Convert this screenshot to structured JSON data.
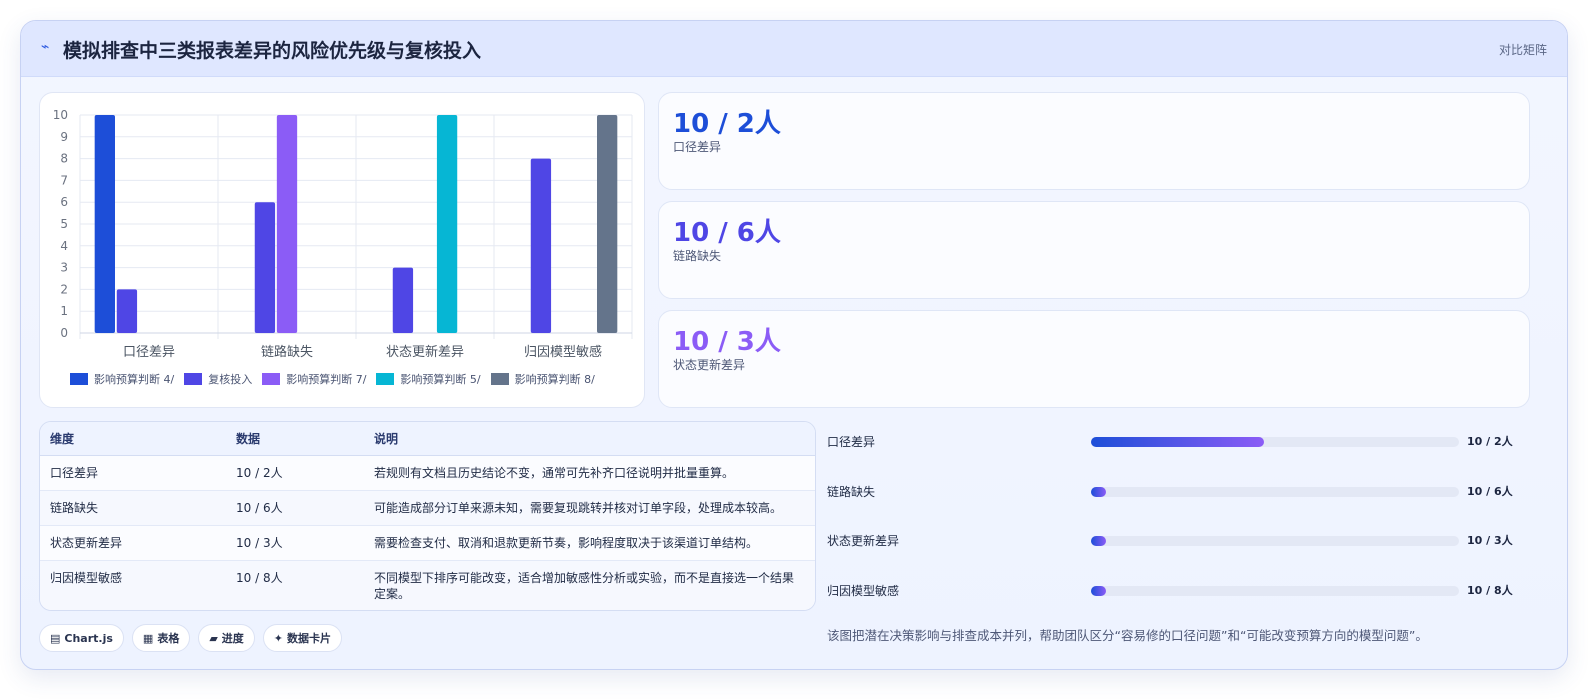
{
  "header": {
    "icon": "lightning-icon",
    "title": "模拟排查中三类报表差异的风险优先级与复核投入",
    "right_label": "对比矩阵"
  },
  "chart_data": {
    "type": "bar",
    "categories": [
      "口径差异",
      "链路缺失",
      "状态更新差异",
      "归因模型敏感"
    ],
    "ylim": [
      0,
      10
    ],
    "yticks": [
      0,
      1,
      2,
      3,
      4,
      5,
      6,
      7,
      8,
      9,
      10
    ],
    "grid": true,
    "legend_position": "bottom",
    "series": [
      {
        "name": "影响预算判断 4/",
        "color": "#1d4ed8",
        "values": [
          10,
          null,
          null,
          null
        ]
      },
      {
        "name": "复核投入",
        "color": "#4f46e5",
        "values": [
          2,
          6,
          3,
          8
        ]
      },
      {
        "name": "影响预算判断 7/",
        "color": "#8b5cf6",
        "values": [
          null,
          10,
          null,
          null
        ]
      },
      {
        "name": "影响预算判断 5/",
        "color": "#06b6d4",
        "values": [
          null,
          null,
          10,
          null
        ]
      },
      {
        "name": "影响预算判断 8/",
        "color": "#64748b",
        "values": [
          null,
          null,
          null,
          10
        ]
      }
    ]
  },
  "kpis": [
    {
      "value": "10 / 2人",
      "label": "口径差异",
      "color": "#1d4ed8"
    },
    {
      "value": "10 / 6人",
      "label": "链路缺失",
      "color": "#4f46e5"
    },
    {
      "value": "10 / 3人",
      "label": "状态更新差异",
      "color": "#8b5cf6"
    }
  ],
  "table": {
    "headers": [
      "维度",
      "数据",
      "说明"
    ],
    "rows": [
      [
        "口径差异",
        "10 / 2人",
        "若规则有文档且历史结论不变，通常可先补齐口径说明并批量重算。"
      ],
      [
        "链路缺失",
        "10 / 6人",
        "可能造成部分订单来源未知，需要复现跳转并核对订单字段，处理成本较高。"
      ],
      [
        "状态更新差异",
        "10 / 3人",
        "需要检查支付、取消和退款更新节奏，影响程度取决于该渠道订单结构。"
      ],
      [
        "归因模型敏感",
        "10 / 8人",
        "不同模型下排序可能改变，适合增加敏感性分析或实验，而不是直接选一个结果定案。"
      ]
    ]
  },
  "progress": [
    {
      "label": "口径差异",
      "value": "10 / 2人",
      "fill_fraction": 0.47
    },
    {
      "label": "链路缺失",
      "value": "10 / 6人",
      "fill_fraction": 0.04
    },
    {
      "label": "状态更新差异",
      "value": "10 / 3人",
      "fill_fraction": 0.04
    },
    {
      "label": "归因模型敏感",
      "value": "10 / 8人",
      "fill_fraction": 0.04
    }
  ],
  "chips": [
    {
      "icon": "chart-icon",
      "glyph": "▤",
      "label": "Chart.js"
    },
    {
      "icon": "table-icon",
      "glyph": "▦",
      "label": "表格"
    },
    {
      "icon": "progress-icon",
      "glyph": "▰",
      "label": "进度"
    },
    {
      "icon": "sparkle-icon",
      "glyph": "✦",
      "label": "数据卡片"
    }
  ],
  "note": "该图把潜在决策影响与排查成本并列，帮助团队区分“容易修的口径问题”和“可能改变预算方向的模型问题”。"
}
